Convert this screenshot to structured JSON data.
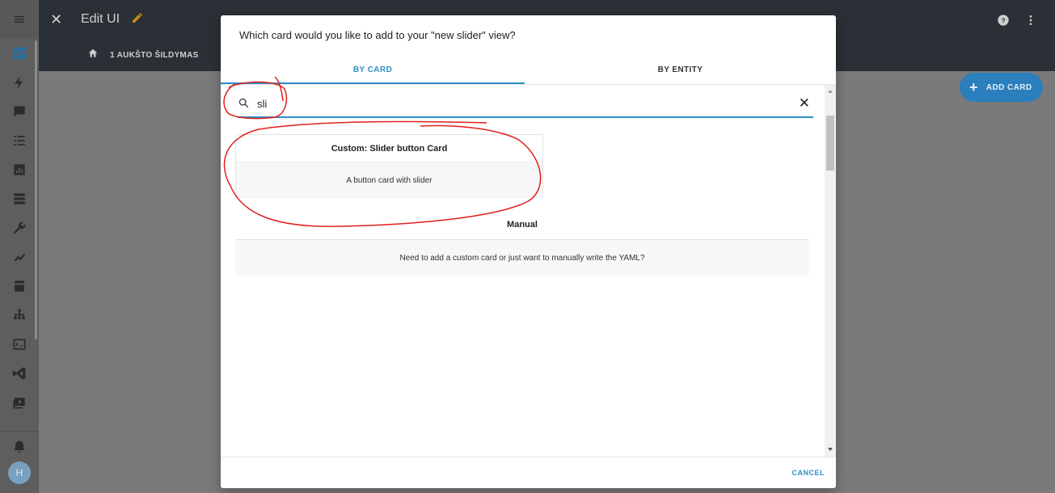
{
  "app": {
    "title": "Edit UI",
    "view_tab": "1 AUKŠTO ŠILDYMAS",
    "add_card_label": "ADD CARD"
  },
  "sidebar": {
    "avatar_initial": "H",
    "items": [
      {
        "icon": "dashboard-icon",
        "active": true
      },
      {
        "icon": "energy-icon"
      },
      {
        "icon": "map-icon"
      },
      {
        "icon": "logbook-icon"
      },
      {
        "icon": "history-icon"
      },
      {
        "icon": "media-icon"
      },
      {
        "icon": "developer-tools-icon"
      },
      {
        "icon": "hacs-icon"
      },
      {
        "icon": "store-icon"
      },
      {
        "icon": "network-icon"
      },
      {
        "icon": "terminal-icon"
      },
      {
        "icon": "vscode-icon"
      },
      {
        "icon": "media-player-icon"
      }
    ]
  },
  "dialog": {
    "title": "Which card would you like to add to your \"new slider\" view?",
    "tabs": [
      {
        "label": "BY CARD",
        "active": true
      },
      {
        "label": "BY ENTITY",
        "active": false
      }
    ],
    "search": {
      "value": "sli"
    },
    "results": [
      {
        "title": "Custom: Slider button Card",
        "description": "A button card with slider"
      }
    ],
    "manual": {
      "title": "Manual",
      "description": "Need to add a custom card or just want to manually write the YAML?"
    },
    "cancel_label": "CANCEL"
  },
  "colors": {
    "accent": "#2e8ec6",
    "header_bg": "#2a3035",
    "annotation": "#e0201b",
    "pencil": "#c38a1c"
  }
}
